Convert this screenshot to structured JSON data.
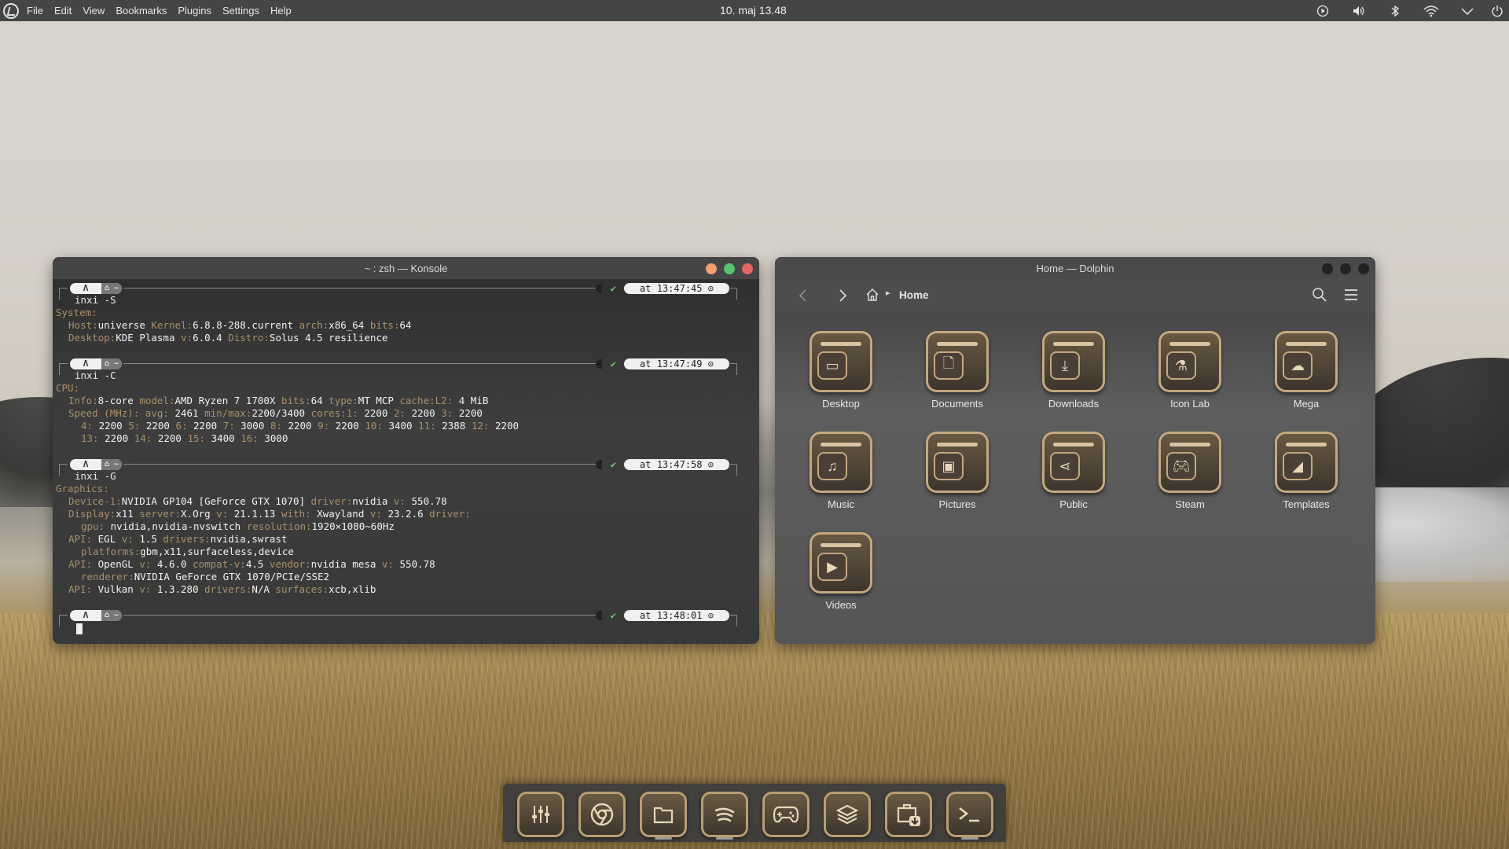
{
  "top_panel": {
    "menu": [
      "File",
      "Edit",
      "View",
      "Bookmarks",
      "Plugins",
      "Settings",
      "Help"
    ],
    "clock": "10. maj  13.48",
    "tray_icons": [
      "media-play-icon",
      "volume-icon",
      "bluetooth-icon",
      "wifi-icon",
      "chevron-down-icon",
      "power-icon"
    ]
  },
  "konsole": {
    "title": "~ : zsh — Konsole",
    "prompts": [
      {
        "time": "at 13:47:45",
        "home": "~",
        "command": "inxi -S"
      },
      {
        "time": "at 13:47:49",
        "home": "~",
        "command": "inxi -C"
      },
      {
        "time": "at 13:47:58",
        "home": "~",
        "command": "inxi -G"
      },
      {
        "time": "at 13:48:01",
        "home": "~",
        "command": ""
      }
    ],
    "output": {
      "system_header": "System:",
      "system_l1": {
        "k1": "Host:",
        "v1": "universe",
        "k2": " Kernel:",
        "v2": "6.8.8-288.current",
        "k3": " arch:",
        "v3": "x86_64",
        "k4": " bits:",
        "v4": "64"
      },
      "system_l2": {
        "k1": "Desktop:",
        "v1": "KDE Plasma",
        "k2": " v:",
        "v2": "6.0.4",
        "k3": " Distro:",
        "v3": "Solus 4.5 resilience"
      },
      "cpu_header": "CPU:",
      "cpu_l1": {
        "k1": "Info:",
        "v1": "8-core",
        "k2": " model:",
        "v2": "AMD Ryzen 7 1700X",
        "k3": " bits:",
        "v3": "64",
        "k4": " type:",
        "v4": "MT MCP",
        "k5": " cache:",
        "k6": "L2:",
        "v6": "4 MiB"
      },
      "cpu_l2": {
        "k1": "Speed (MHz):",
        "k2": " avg:",
        "v2": "2461",
        "k3": " min/max:",
        "v3": "2200/3400",
        "k4": " cores:",
        "k5": "1:",
        "v5": "2200",
        "k6": " 2:",
        "v6": "2200",
        "k7": " 3:",
        "v7": "2200"
      },
      "cpu_l3": {
        "k1": "4:",
        "v1": "2200",
        "k2": " 5:",
        "v2": "2200",
        "k3": " 6:",
        "v3": "2200",
        "k4": " 7:",
        "v4": "3000",
        "k5": " 8:",
        "v5": "2200",
        "k6": " 9:",
        "v6": "2200",
        "k7": " 10:",
        "v7": "3400",
        "k8": " 11:",
        "v8": "2388",
        "k9": " 12:",
        "v9": "2200"
      },
      "cpu_l4": {
        "k1": "13:",
        "v1": "2200",
        "k2": " 14:",
        "v2": "2200",
        "k3": " 15:",
        "v3": "3400",
        "k4": " 16:",
        "v4": "3000"
      },
      "gfx_header": "Graphics:",
      "gfx_l1": {
        "k1": "Device-1:",
        "v1": "NVIDIA GP104 [GeForce GTX 1070]",
        "k2": " driver:",
        "v2": "nvidia",
        "k3": " v:",
        "v3": "550.78"
      },
      "gfx_l2": {
        "k1": "Display:",
        "v1": "x11",
        "k2": " server:",
        "v2": "X.Org",
        "k3": " v:",
        "v3": "21.1.13",
        "k4": " with:",
        "v4": "Xwayland",
        "k5": " v:",
        "v5": "23.2.6",
        "k6": " driver:"
      },
      "gfx_l3": {
        "k1": "gpu:",
        "v1": "nvidia,nvidia-nvswitch",
        "k2": " resolution:",
        "v2": "1920×1080~60Hz"
      },
      "gfx_l4": {
        "k1": "API:",
        "v1": "EGL",
        "k2": " v:",
        "v2": "1.5",
        "k3": " drivers:",
        "v3": "nvidia,swrast"
      },
      "gfx_l5": {
        "k1": "platforms:",
        "v1": "gbm,x11,surfaceless,device"
      },
      "gfx_l6": {
        "k1": "API:",
        "v1": "OpenGL",
        "k2": " v:",
        "v2": "4.6.0",
        "k3": " compat-v:",
        "v3": "4.5",
        "k4": " vendor:",
        "v4": "nvidia mesa",
        "k5": " v:",
        "v5": "550.78"
      },
      "gfx_l7": {
        "k1": "renderer:",
        "v1": "NVIDIA GeForce GTX 1070/PCIe/SSE2"
      },
      "gfx_l8": {
        "k1": "API:",
        "v1": "Vulkan",
        "k2": " v:",
        "v2": "1.3.280",
        "k3": " drivers:",
        "v3": "N/A",
        "k4": " surfaces:",
        "v4": "xcb,xlib"
      }
    }
  },
  "dolphin": {
    "title": "Home — Dolphin",
    "breadcrumb": "Home",
    "folders": [
      {
        "label": "Desktop",
        "icon": "desktop-icon"
      },
      {
        "label": "Documents",
        "icon": "document-icon"
      },
      {
        "label": "Downloads",
        "icon": "download-icon"
      },
      {
        "label": "Icon Lab",
        "icon": "flask-icon"
      },
      {
        "label": "Mega",
        "icon": "cloud-icon"
      },
      {
        "label": "Music",
        "icon": "music-note-icon"
      },
      {
        "label": "Pictures",
        "icon": "picture-icon"
      },
      {
        "label": "Public",
        "icon": "share-icon"
      },
      {
        "label": "Steam",
        "icon": "gamepad-icon"
      },
      {
        "label": "Templates",
        "icon": "template-icon"
      },
      {
        "label": "Videos",
        "icon": "play-icon"
      }
    ]
  },
  "dock": {
    "items": [
      "mixer-icon",
      "chrome-icon",
      "files-icon",
      "spotify-icon",
      "gamepad-icon",
      "layers-icon",
      "software-center-icon",
      "terminal-icon"
    ]
  }
}
